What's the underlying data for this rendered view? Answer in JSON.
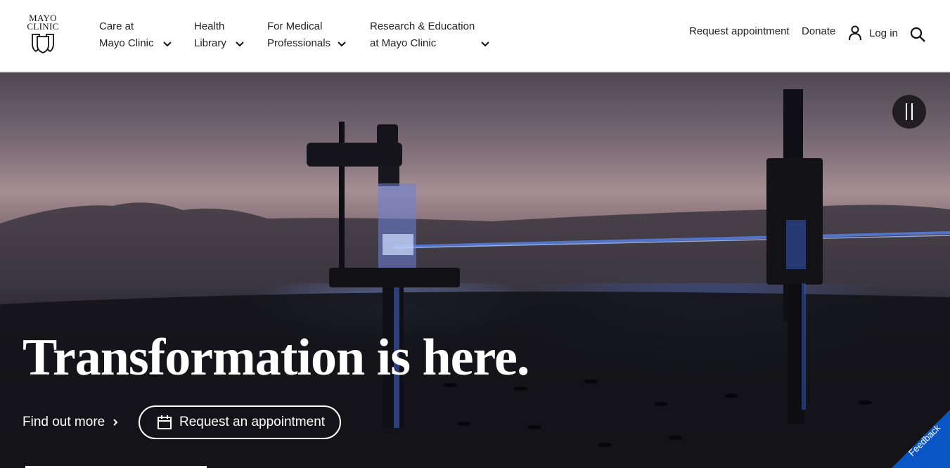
{
  "header": {
    "logo": {
      "line1": "MAYO",
      "line2": "CLINIC"
    },
    "nav": [
      {
        "line1": "Care at",
        "line2": "Mayo Clinic"
      },
      {
        "line1": "Health",
        "line2": "Library"
      },
      {
        "line1": "For Medical",
        "line2": "Professionals"
      },
      {
        "line1": "Research & Education",
        "line2": "at Mayo Clinic"
      }
    ],
    "utility": {
      "request_appointment": "Request appointment",
      "donate": "Donate",
      "login": "Log in"
    }
  },
  "hero": {
    "title": "Transformation is here.",
    "find_more": "Find out more",
    "request_button": "Request an appointment"
  },
  "feedback": {
    "label": "Feedback"
  },
  "colors": {
    "feedback_bg": "#0a56c6",
    "text_dark": "#222222",
    "hero_text": "#ffffff"
  },
  "icons": [
    "mayo-shield-icon",
    "chevron-down-icon",
    "user-icon",
    "search-icon",
    "pause-icon",
    "chevron-right-icon",
    "calendar-icon"
  ]
}
